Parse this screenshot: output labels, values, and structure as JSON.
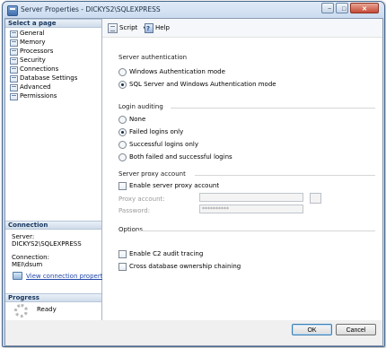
{
  "window": {
    "title": "Server Properties - DICKYS2\\SQLEXPRESS",
    "minimize_label": "−",
    "maximize_label": "□",
    "close_label": "✕"
  },
  "left_pane": {
    "select_page_header": "Select a page",
    "pages": [
      {
        "label": "General",
        "icon": "page-icon"
      },
      {
        "label": "Memory",
        "icon": "page-icon"
      },
      {
        "label": "Processors",
        "icon": "page-icon"
      },
      {
        "label": "Security",
        "icon": "page-icon"
      },
      {
        "label": "Connections",
        "icon": "page-icon"
      },
      {
        "label": "Database Settings",
        "icon": "page-icon"
      },
      {
        "label": "Advanced",
        "icon": "page-icon"
      },
      {
        "label": "Permissions",
        "icon": "page-icon"
      }
    ],
    "connection_header": "Connection",
    "server_label": "Server:",
    "server_value": "DICKYS2\\SQLEXPRESS",
    "connection_label": "Connection:",
    "connection_value": "MEI\\dsum",
    "view_connection_link": "View connection properties",
    "progress_header": "Progress",
    "progress_status": "Ready"
  },
  "toolbar": {
    "script_label": "Script",
    "script_arrow": "▼",
    "help_label": "Help"
  },
  "main": {
    "server_auth_title": "Server authentication",
    "auth_options": [
      {
        "label": "Windows Authentication mode",
        "selected": false
      },
      {
        "label": "SQL Server and Windows Authentication mode",
        "selected": true
      }
    ],
    "login_auditing_title": "Login auditing",
    "audit_options": [
      {
        "label": "None",
        "selected": false
      },
      {
        "label": "Failed logins only",
        "selected": true
      },
      {
        "label": "Successful logins only",
        "selected": false
      },
      {
        "label": "Both failed and successful logins",
        "selected": false
      }
    ],
    "proxy_title": "Server proxy account",
    "proxy_checkbox_label": "Enable server proxy account",
    "proxy_account_label": "Proxy account:",
    "password_label": "Password:",
    "password_value": "**********",
    "options_title": "Options",
    "c2_label": "Enable C2 audit tracing",
    "chaining_label": "Cross database ownership chaining"
  },
  "footer": {
    "ok_label": "OK",
    "cancel_label": "Cancel"
  }
}
